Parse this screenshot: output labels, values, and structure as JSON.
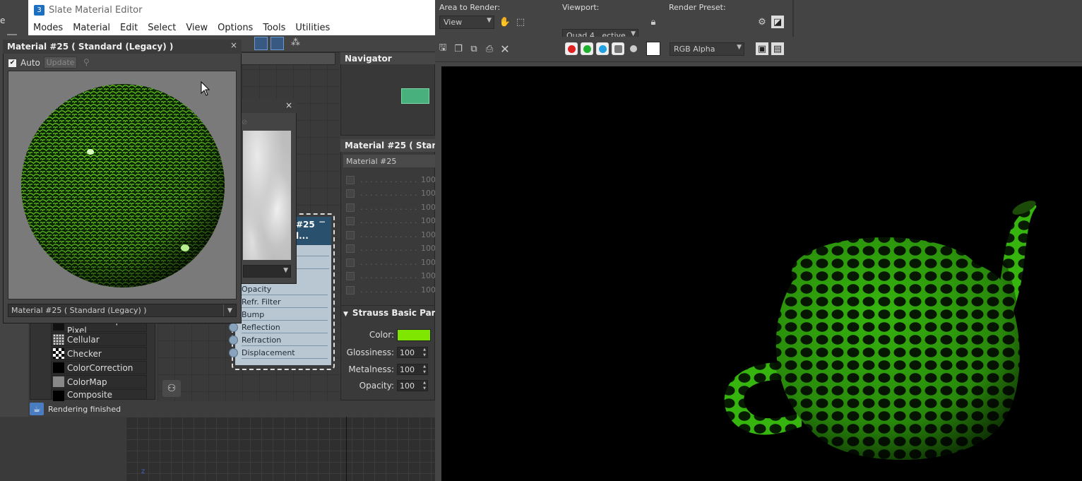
{
  "slate": {
    "title": "Slate Material Editor",
    "menu": [
      "Modes",
      "Material",
      "Edit",
      "Select",
      "View",
      "Options",
      "Tools",
      "Utilities"
    ],
    "status": "Rendering finished"
  },
  "preview_window": {
    "title": "Material #25  ( Standard (Legacy) )",
    "close": "×",
    "auto_label": "Auto",
    "update_label": "Update",
    "material_dropdown": "Material #25  ( Standard (Legacy) )"
  },
  "navigator": {
    "title": "Navigator"
  },
  "params": {
    "title": "Material #25  ( Standa",
    "name": "Material #25",
    "maps_pct": [
      "100",
      "100",
      "100",
      "100",
      "100",
      "100",
      "100",
      "100",
      "100"
    ],
    "dots": ". . . . . . . . . . . .",
    "strauss_title": "Strauss Basic Param",
    "color_label": "Color:",
    "color_value": "#7ee600",
    "glossiness_label": "Glossiness:",
    "glossiness_value": "100",
    "metalness_label": "Metalness:",
    "metalness_value": "100",
    "opacity_label": "Opacity:",
    "opacity_value": "100"
  },
  "node": {
    "title_line1": "#25",
    "title_line2": "l...",
    "slots": [
      "Opacity",
      "Refr. Filter",
      "Bump",
      "Reflection",
      "Refraction",
      "Displacement"
    ]
  },
  "browser": {
    "items": [
      {
        "label": "Camera Map Per Pixel",
        "swatch": "#111"
      },
      {
        "label": "Cellular",
        "swatch": "#bbb"
      },
      {
        "label": "Checker",
        "swatch": "#fff"
      },
      {
        "label": "ColorCorrection",
        "swatch": "#000"
      },
      {
        "label": "ColorMap",
        "swatch": "#888"
      },
      {
        "label": "Composite",
        "swatch": "#000"
      }
    ]
  },
  "render": {
    "area_label": "Area to Render:",
    "area_value": "View",
    "viewport_label": "Viewport:",
    "viewport_value": "Quad 4...ective",
    "preset_label": "Render Preset:",
    "preset_value": "",
    "channel_value": "RGB Alpha"
  }
}
